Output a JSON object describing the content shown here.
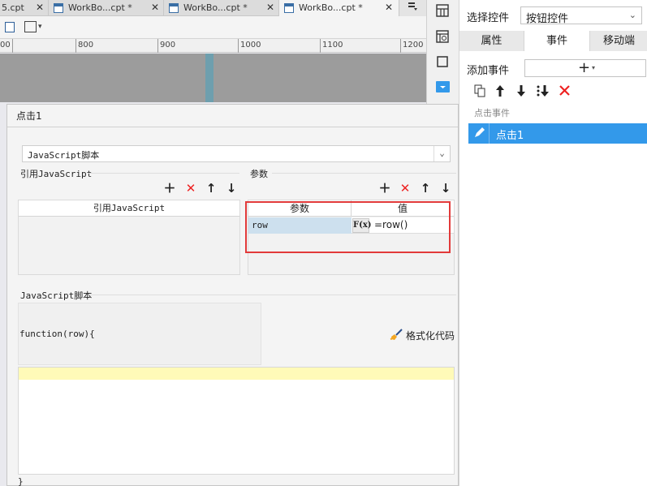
{
  "tabs": [
    {
      "label": "5.cpt",
      "active": false
    },
    {
      "label": "WorkBo...cpt *",
      "active": false
    },
    {
      "label": "WorkBo...cpt *",
      "active": false
    },
    {
      "label": "WorkBo...cpt *",
      "active": true
    }
  ],
  "tab_close": "✕",
  "ruler": [
    "00",
    "800",
    "900",
    "1000",
    "1100",
    "1200"
  ],
  "right_panel": {
    "select_label": "选择控件",
    "select_value": "按钮控件",
    "tabs": [
      "属性",
      "事件",
      "移动端"
    ],
    "add_event_label": "添加事件",
    "add_glyph": "+",
    "section_label": "点击事件",
    "events": [
      "点击1"
    ]
  },
  "dialog": {
    "title": "点击1",
    "type_value": "JavaScript脚本",
    "ref_js": {
      "label": "引用JavaScript",
      "column": "引用JavaScript"
    },
    "params": {
      "label": "参数",
      "columns": [
        "参数",
        "值"
      ],
      "rows": [
        {
          "name": "row",
          "formula_icon": "F(x)",
          "value": "=row()"
        }
      ]
    },
    "script": {
      "label": "JavaScript脚本",
      "function_signature": "function(row){",
      "format_button": "格式化代码",
      "closing": "}"
    }
  },
  "colors": {
    "accent": "#3399ea",
    "highlight_border": "#e23a3a",
    "line_highlight": "#fffab8",
    "cell_selected": "#cde0ee"
  }
}
